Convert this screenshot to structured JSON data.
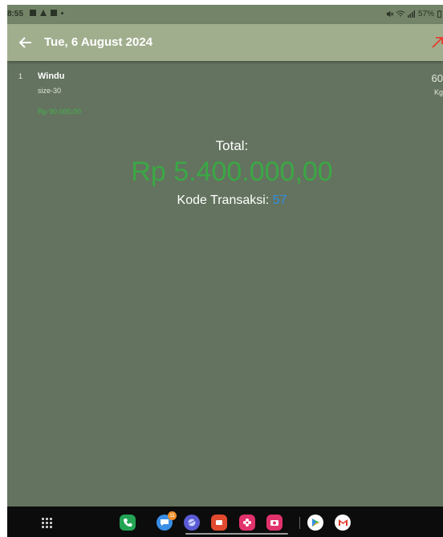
{
  "status_bar": {
    "time": "8:55",
    "battery": "57%",
    "icons": [
      "gallery-icon",
      "alert-icon",
      "calendar-icon",
      "dot-icon",
      "mute-icon",
      "wifi-icon",
      "signal-icon",
      "battery-icon"
    ]
  },
  "app_bar": {
    "title": "Tue, 6 August 2024",
    "icons": [
      "back-arrow-icon",
      "export-arrow-icon"
    ]
  },
  "items": [
    {
      "index": "1",
      "name": "Windu",
      "size": "size-30",
      "price": "Rp 90.000,00",
      "quantity": "60",
      "unit": "Kg"
    }
  ],
  "summary": {
    "total_label": "Total:",
    "total_amount": "Rp 5.400.000,00",
    "kode_label": "Kode Transaksi: ",
    "kode_value": "57"
  },
  "nav_bar": {
    "dock_apps": [
      {
        "name": "phone",
        "color": "#23a455",
        "badge": ""
      },
      {
        "name": "messages",
        "color": "#3a8ee6",
        "badge": "11"
      },
      {
        "name": "internet",
        "color": "#5b5bd6",
        "badge": ""
      },
      {
        "name": "slides",
        "color": "#e24a2f",
        "badge": ""
      },
      {
        "name": "flower-app",
        "color": "#e2326c",
        "badge": ""
      },
      {
        "name": "camera",
        "color": "#e2326c",
        "badge": ""
      },
      {
        "name": "play-store",
        "color": "#ffffff",
        "badge": ""
      },
      {
        "name": "gmail",
        "color": "#ffffff",
        "badge": ""
      }
    ]
  },
  "colors": {
    "background": "#64735f",
    "app_bar": "#a1ae8e",
    "price_green": "#43b34c",
    "total_green": "#3aa845",
    "kode_blue": "#2f8ee0",
    "export_red": "#e63b2e"
  }
}
